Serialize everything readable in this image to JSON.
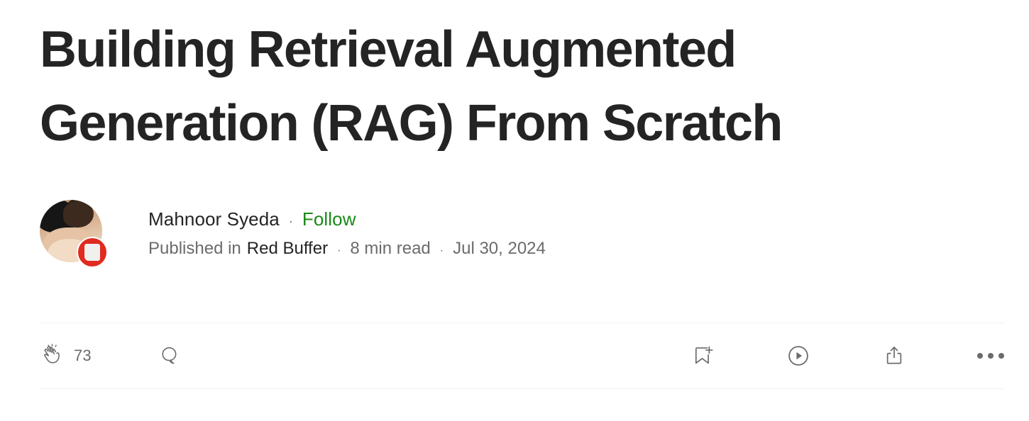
{
  "article": {
    "title": "Building Retrieval Augmented Generation (RAG) From Scratch"
  },
  "byline": {
    "author_name": "Mahnoor Syeda",
    "separator": "·",
    "follow_label": "Follow",
    "published_in_label": "Published in",
    "publication_name": "Red Buffer",
    "read_time": "8 min read",
    "publish_date": "Jul 30, 2024",
    "avatar_name": "author-avatar",
    "badge_name": "publication-badge"
  },
  "actions": {
    "clap_count": "73",
    "clap_icon": "clap-icon",
    "comment_icon": "comment-icon",
    "bookmark_icon": "bookmark-add-icon",
    "listen_icon": "listen-play-icon",
    "share_icon": "share-icon",
    "more_icon": "more-options-icon"
  },
  "colors": {
    "text_primary": "#242424",
    "text_secondary": "#6b6b6b",
    "follow_green": "#1a8917",
    "badge_red": "#e02b20",
    "divider": "#f2f2f2",
    "background": "#ffffff"
  }
}
